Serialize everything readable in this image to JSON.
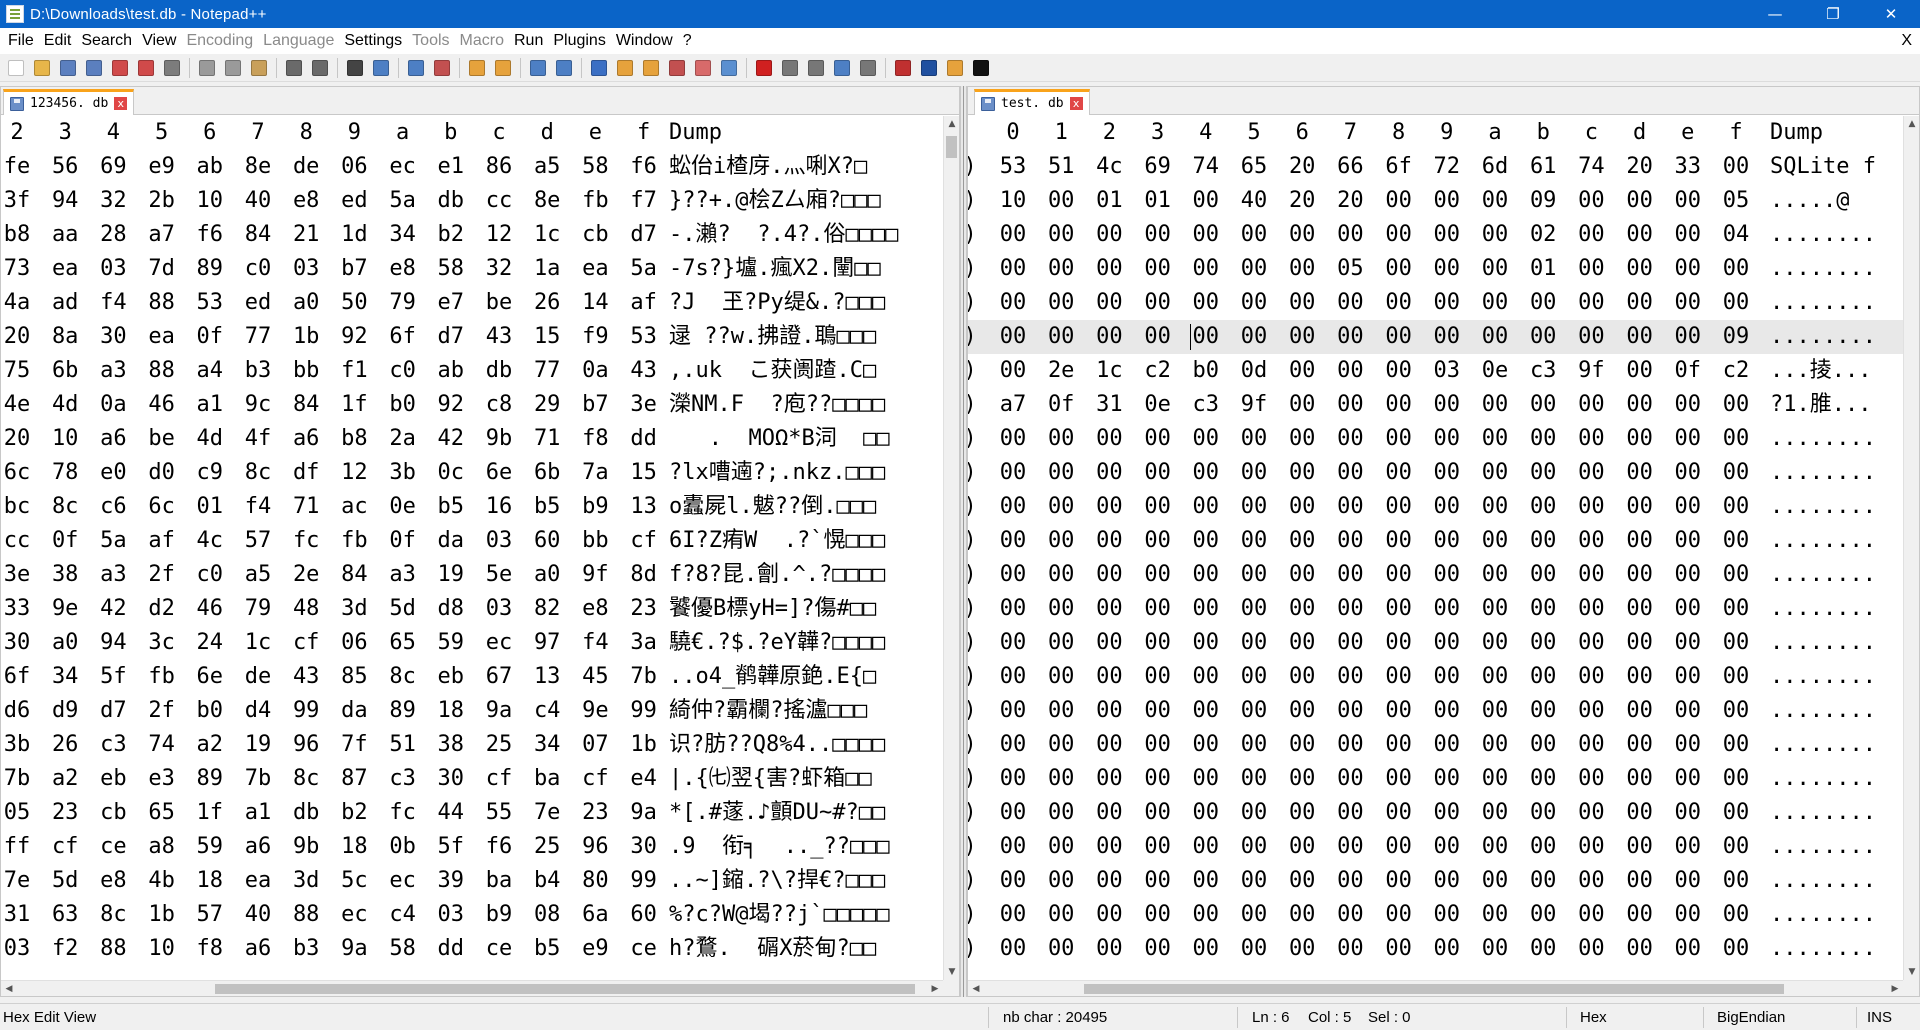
{
  "window": {
    "title": "D:\\Downloads\\test.db - Notepad++",
    "minimize": "—",
    "maximize": "❐",
    "close": "✕"
  },
  "menu": {
    "items": [
      "File",
      "Edit",
      "Search",
      "View",
      "Encoding",
      "Language",
      "Settings",
      "Tools",
      "Macro",
      "Run",
      "Plugins",
      "Window",
      "?"
    ],
    "disabled": [
      "Encoding",
      "Language",
      "Tools",
      "Macro"
    ],
    "close_doc": "X"
  },
  "toolbar": {
    "icons": [
      {
        "name": "new-file-icon",
        "color": "#ffffff"
      },
      {
        "name": "open-file-icon",
        "color": "#e7b64a"
      },
      {
        "name": "save-icon",
        "color": "#5b7fbf"
      },
      {
        "name": "save-all-icon",
        "color": "#5b7fbf"
      },
      {
        "name": "close-icon",
        "color": "#d04a4a"
      },
      {
        "name": "close-all-icon",
        "color": "#d04a4a"
      },
      {
        "name": "print-icon",
        "color": "#7c7c7c"
      },
      {
        "name": "sep"
      },
      {
        "name": "cut-icon",
        "color": "#9a9a9a"
      },
      {
        "name": "copy-icon",
        "color": "#9a9a9a"
      },
      {
        "name": "paste-icon",
        "color": "#c9a05a"
      },
      {
        "name": "sep"
      },
      {
        "name": "undo-icon",
        "color": "#6a6a6a"
      },
      {
        "name": "redo-icon",
        "color": "#6a6a6a"
      },
      {
        "name": "sep"
      },
      {
        "name": "find-icon",
        "color": "#444444"
      },
      {
        "name": "replace-icon",
        "color": "#4d7fc4"
      },
      {
        "name": "sep"
      },
      {
        "name": "zoom-in-icon",
        "color": "#4d7fc4"
      },
      {
        "name": "zoom-out-icon",
        "color": "#c25050"
      },
      {
        "name": "sep"
      },
      {
        "name": "sync-vertical-icon",
        "color": "#e6a23c"
      },
      {
        "name": "sync-horizontal-icon",
        "color": "#e6a23c"
      },
      {
        "name": "sep"
      },
      {
        "name": "word-wrap-icon",
        "color": "#4d7fc4"
      },
      {
        "name": "show-all-chars-icon",
        "color": "#4d7fc4"
      },
      {
        "name": "sep"
      },
      {
        "name": "indent-guide-icon",
        "color": "#3b6fc4"
      },
      {
        "name": "doc-map-icon",
        "color": "#e6a23c"
      },
      {
        "name": "function-list-icon",
        "color": "#e6a23c"
      },
      {
        "name": "folder-workspace-icon",
        "color": "#c25050"
      },
      {
        "name": "doc-list-icon",
        "color": "#d86a6a"
      },
      {
        "name": "monitoring-icon",
        "color": "#5a8fd0"
      },
      {
        "name": "sep"
      },
      {
        "name": "record-macro-icon",
        "color": "#d02020"
      },
      {
        "name": "stop-macro-icon",
        "color": "#777777"
      },
      {
        "name": "play-macro-icon",
        "color": "#777777"
      },
      {
        "name": "run-macro-multiple-icon",
        "color": "#4d7fc4"
      },
      {
        "name": "save-macro-icon",
        "color": "#777777"
      },
      {
        "name": "sep"
      },
      {
        "name": "spell-check-icon",
        "color": "#c03030"
      },
      {
        "name": "hex-editor-icon",
        "color": "#2050a0"
      },
      {
        "name": "explorer-icon",
        "color": "#e6a23c"
      },
      {
        "name": "markdown-icon",
        "color": "#111111"
      }
    ]
  },
  "left_pane": {
    "tab": {
      "name": "123456. db",
      "close": "x"
    },
    "header": {
      "cols": [
        "2",
        "3",
        "4",
        "5",
        "6",
        "7",
        "8",
        "9",
        "a",
        "b",
        "c",
        "d",
        "e",
        "f"
      ],
      "dump": "Dump"
    },
    "rows": [
      {
        "hex": [
          "fe",
          "56",
          "69",
          "e9",
          "ab",
          "8e",
          "de",
          "06",
          "ec",
          "e1",
          "86",
          "a5",
          "58",
          "f6"
        ],
        "dump": "蚣佁i楂庌.灬唎X?□"
      },
      {
        "hex": [
          "3f",
          "94",
          "32",
          "2b",
          "10",
          "40",
          "e8",
          "ed",
          "5a",
          "db",
          "cc",
          "8e",
          "fb",
          "f7"
        ],
        "dump": "}??+.@桧Z厶廂?□□□"
      },
      {
        "hex": [
          "b8",
          "aa",
          "28",
          "a7",
          "f6",
          "84",
          "21",
          "1d",
          "34",
          "b2",
          "12",
          "1c",
          "cb",
          "d7"
        ],
        "dump": "-.瀨?  ?.4?.俗□□□□"
      },
      {
        "hex": [
          "73",
          "ea",
          "03",
          "7d",
          "89",
          "c0",
          "03",
          "b7",
          "e8",
          "58",
          "32",
          "1a",
          "ea",
          "5a"
        ],
        "dump": "-7s?}壚.瘋X2.闉□□"
      },
      {
        "hex": [
          "4a",
          "ad",
          "f4",
          "88",
          "53",
          "ed",
          "a0",
          "50",
          "79",
          "e7",
          "be",
          "26",
          "14",
          "af"
        ],
        "dump": "?J  玊?Py缇&.?□□□"
      },
      {
        "hex": [
          "20",
          "8a",
          "30",
          "ea",
          "0f",
          "77",
          "1b",
          "92",
          "6f",
          "d7",
          "43",
          "15",
          "f9",
          "53"
        ],
        "dump": "逯 ??w.拂證.鵈□□□"
      },
      {
        "hex": [
          "75",
          "6b",
          "a3",
          "88",
          "a4",
          "b3",
          "bb",
          "f1",
          "c0",
          "ab",
          "db",
          "77",
          "0a",
          "43"
        ],
        "dump": ",.uk  こ获阓蹅.C□"
      },
      {
        "hex": [
          "4e",
          "4d",
          "0a",
          "46",
          "a1",
          "9c",
          "84",
          "1f",
          "b0",
          "92",
          "c8",
          "29",
          "b7",
          "3e"
        ],
        "dump": "濚NM.F  ?庖??□□□□"
      },
      {
        "hex": [
          "20",
          "10",
          "a6",
          "be",
          "4d",
          "4f",
          "a6",
          "b8",
          "2a",
          "42",
          "9b",
          "71",
          "f8",
          "dd"
        ],
        "dump": "   .  MOΩ*B泀  □□"
      },
      {
        "hex": [
          "6c",
          "78",
          "e0",
          "d0",
          "c9",
          "8c",
          "df",
          "12",
          "3b",
          "0c",
          "6e",
          "6b",
          "7a",
          "15"
        ],
        "dump": "?lx嘈遖?;.nkz.□□□"
      },
      {
        "hex": [
          "bc",
          "8c",
          "c6",
          "6c",
          "01",
          "f4",
          "71",
          "ac",
          "0e",
          "b5",
          "16",
          "b5",
          "b9",
          "13"
        ],
        "dump": "o蠹屍l.魃??倒.□□□"
      },
      {
        "hex": [
          "cc",
          "0f",
          "5a",
          "af",
          "4c",
          "57",
          "fc",
          "fb",
          "0f",
          "da",
          "03",
          "60",
          "bb",
          "cf"
        ],
        "dump": "6I?Z痏W  .?`愰□□□"
      },
      {
        "hex": [
          "3e",
          "38",
          "a3",
          "2f",
          "c0",
          "a5",
          "2e",
          "84",
          "a3",
          "19",
          "5e",
          "a0",
          "9f",
          "8d"
        ],
        "dump": "f?8?昆.劊.^.?□□□□"
      },
      {
        "hex": [
          "33",
          "9e",
          "42",
          "d2",
          "46",
          "79",
          "48",
          "3d",
          "5d",
          "d8",
          "03",
          "82",
          "e8",
          "23"
        ],
        "dump": "饕優B標yH=]?傷#□□"
      },
      {
        "hex": [
          "30",
          "a0",
          "94",
          "3c",
          "24",
          "1c",
          "cf",
          "06",
          "65",
          "59",
          "ec",
          "97",
          "f4",
          "3a"
        ],
        "dump": "驍€.?$.?eY韡?□□□□"
      },
      {
        "hex": [
          "6f",
          "34",
          "5f",
          "fb",
          "6e",
          "de",
          "43",
          "85",
          "8c",
          "eb",
          "67",
          "13",
          "45",
          "7b"
        ],
        "dump": "..o4_鹡韡原銫.E{□"
      },
      {
        "hex": [
          "d6",
          "d9",
          "d7",
          "2f",
          "b0",
          "d4",
          "99",
          "da",
          "89",
          "18",
          "9a",
          "c4",
          "9e",
          "99"
        ],
        "dump": "綺仲?霸欄?搖瀘□□□"
      },
      {
        "hex": [
          "3b",
          "26",
          "c3",
          "74",
          "a2",
          "19",
          "96",
          "7f",
          "51",
          "38",
          "25",
          "34",
          "07",
          "1b"
        ],
        "dump": "识?肪??Q8%4..□□□□"
      },
      {
        "hex": [
          "7b",
          "a2",
          "eb",
          "e3",
          "89",
          "7b",
          "8c",
          "87",
          "c3",
          "30",
          "cf",
          "ba",
          "cf",
          "e4"
        ],
        "dump": "|.{㈦翌{害?虾箱□□"
      },
      {
        "hex": [
          "05",
          "23",
          "cb",
          "65",
          "1f",
          "a1",
          "db",
          "b2",
          "fc",
          "44",
          "55",
          "7e",
          "23",
          "9a"
        ],
        "dump": "*[.#蓫.♪顫DU~#?□□"
      },
      {
        "hex": [
          "ff",
          "cf",
          "ce",
          "a8",
          "59",
          "a6",
          "9b",
          "18",
          "0b",
          "5f",
          "f6",
          "25",
          "96",
          "30"
        ],
        "dump": ".9  衔╕  .._??□□□"
      },
      {
        "hex": [
          "7e",
          "5d",
          "e8",
          "4b",
          "18",
          "ea",
          "3d",
          "5c",
          "ec",
          "39",
          "ba",
          "b4",
          "80",
          "99"
        ],
        "dump": "..~]鏥.?\\?捍€?□□□"
      },
      {
        "hex": [
          "31",
          "63",
          "8c",
          "1b",
          "57",
          "40",
          "88",
          "ec",
          "c4",
          "03",
          "b9",
          "08",
          "6a",
          "60"
        ],
        "dump": "%?c?W@堨??j`□□□□□"
      },
      {
        "hex": [
          "03",
          "f2",
          "88",
          "10",
          "f8",
          "a6",
          "b3",
          "9a",
          "58",
          "dd",
          "ce",
          "b5",
          "e9",
          "ce"
        ],
        "dump": "h?鶩.  碿X菸甸?□□"
      }
    ]
  },
  "right_pane": {
    "tab": {
      "name": "test. db",
      "close": "x"
    },
    "header": {
      "cols": [
        "0",
        "1",
        "2",
        "3",
        "4",
        "5",
        "6",
        "7",
        "8",
        "9",
        "a",
        "b",
        "c",
        "d",
        "e",
        "f"
      ],
      "dump": "Dump"
    },
    "highlight_row": 5,
    "rows": [
      {
        "hex": [
          "53",
          "51",
          "4c",
          "69",
          "74",
          "65",
          "20",
          "66",
          "6f",
          "72",
          "6d",
          "61",
          "74",
          "20",
          "33",
          "00"
        ],
        "dump": "SQLite f"
      },
      {
        "hex": [
          "10",
          "00",
          "01",
          "01",
          "00",
          "40",
          "20",
          "20",
          "00",
          "00",
          "00",
          "09",
          "00",
          "00",
          "00",
          "05"
        ],
        "dump": ".....@"
      },
      {
        "hex": [
          "00",
          "00",
          "00",
          "00",
          "00",
          "00",
          "00",
          "00",
          "00",
          "00",
          "00",
          "02",
          "00",
          "00",
          "00",
          "04"
        ],
        "dump": "........"
      },
      {
        "hex": [
          "00",
          "00",
          "00",
          "00",
          "00",
          "00",
          "00",
          "05",
          "00",
          "00",
          "00",
          "01",
          "00",
          "00",
          "00",
          "00"
        ],
        "dump": "........"
      },
      {
        "hex": [
          "00",
          "00",
          "00",
          "00",
          "00",
          "00",
          "00",
          "00",
          "00",
          "00",
          "00",
          "00",
          "00",
          "00",
          "00",
          "00"
        ],
        "dump": "........"
      },
      {
        "hex": [
          "00",
          "00",
          "00",
          "00",
          "00",
          "00",
          "00",
          "00",
          "00",
          "00",
          "00",
          "00",
          "00",
          "00",
          "00",
          "09"
        ],
        "dump": "........"
      },
      {
        "hex": [
          "00",
          "2e",
          "1c",
          "c2",
          "b0",
          "0d",
          "00",
          "00",
          "00",
          "03",
          "0e",
          "c3",
          "9f",
          "00",
          "0f",
          "c2"
        ],
        "dump": "...掕..."
      },
      {
        "hex": [
          "a7",
          "0f",
          "31",
          "0e",
          "c3",
          "9f",
          "00",
          "00",
          "00",
          "00",
          "00",
          "00",
          "00",
          "00",
          "00",
          "00"
        ],
        "dump": "?1.脽..."
      },
      {
        "hex": [
          "00",
          "00",
          "00",
          "00",
          "00",
          "00",
          "00",
          "00",
          "00",
          "00",
          "00",
          "00",
          "00",
          "00",
          "00",
          "00"
        ],
        "dump": "........"
      },
      {
        "hex": [
          "00",
          "00",
          "00",
          "00",
          "00",
          "00",
          "00",
          "00",
          "00",
          "00",
          "00",
          "00",
          "00",
          "00",
          "00",
          "00"
        ],
        "dump": "........"
      },
      {
        "hex": [
          "00",
          "00",
          "00",
          "00",
          "00",
          "00",
          "00",
          "00",
          "00",
          "00",
          "00",
          "00",
          "00",
          "00",
          "00",
          "00"
        ],
        "dump": "........"
      },
      {
        "hex": [
          "00",
          "00",
          "00",
          "00",
          "00",
          "00",
          "00",
          "00",
          "00",
          "00",
          "00",
          "00",
          "00",
          "00",
          "00",
          "00"
        ],
        "dump": "........"
      },
      {
        "hex": [
          "00",
          "00",
          "00",
          "00",
          "00",
          "00",
          "00",
          "00",
          "00",
          "00",
          "00",
          "00",
          "00",
          "00",
          "00",
          "00"
        ],
        "dump": "........"
      },
      {
        "hex": [
          "00",
          "00",
          "00",
          "00",
          "00",
          "00",
          "00",
          "00",
          "00",
          "00",
          "00",
          "00",
          "00",
          "00",
          "00",
          "00"
        ],
        "dump": "........"
      },
      {
        "hex": [
          "00",
          "00",
          "00",
          "00",
          "00",
          "00",
          "00",
          "00",
          "00",
          "00",
          "00",
          "00",
          "00",
          "00",
          "00",
          "00"
        ],
        "dump": "........"
      },
      {
        "hex": [
          "00",
          "00",
          "00",
          "00",
          "00",
          "00",
          "00",
          "00",
          "00",
          "00",
          "00",
          "00",
          "00",
          "00",
          "00",
          "00"
        ],
        "dump": "........"
      },
      {
        "hex": [
          "00",
          "00",
          "00",
          "00",
          "00",
          "00",
          "00",
          "00",
          "00",
          "00",
          "00",
          "00",
          "00",
          "00",
          "00",
          "00"
        ],
        "dump": "........"
      },
      {
        "hex": [
          "00",
          "00",
          "00",
          "00",
          "00",
          "00",
          "00",
          "00",
          "00",
          "00",
          "00",
          "00",
          "00",
          "00",
          "00",
          "00"
        ],
        "dump": "........"
      },
      {
        "hex": [
          "00",
          "00",
          "00",
          "00",
          "00",
          "00",
          "00",
          "00",
          "00",
          "00",
          "00",
          "00",
          "00",
          "00",
          "00",
          "00"
        ],
        "dump": "........"
      },
      {
        "hex": [
          "00",
          "00",
          "00",
          "00",
          "00",
          "00",
          "00",
          "00",
          "00",
          "00",
          "00",
          "00",
          "00",
          "00",
          "00",
          "00"
        ],
        "dump": "........"
      },
      {
        "hex": [
          "00",
          "00",
          "00",
          "00",
          "00",
          "00",
          "00",
          "00",
          "00",
          "00",
          "00",
          "00",
          "00",
          "00",
          "00",
          "00"
        ],
        "dump": "........"
      },
      {
        "hex": [
          "00",
          "00",
          "00",
          "00",
          "00",
          "00",
          "00",
          "00",
          "00",
          "00",
          "00",
          "00",
          "00",
          "00",
          "00",
          "00"
        ],
        "dump": "........"
      },
      {
        "hex": [
          "00",
          "00",
          "00",
          "00",
          "00",
          "00",
          "00",
          "00",
          "00",
          "00",
          "00",
          "00",
          "00",
          "00",
          "00",
          "00"
        ],
        "dump": "........"
      },
      {
        "hex": [
          "00",
          "00",
          "00",
          "00",
          "00",
          "00",
          "00",
          "00",
          "00",
          "00",
          "00",
          "00",
          "00",
          "00",
          "00",
          "00"
        ],
        "dump": "........"
      }
    ]
  },
  "status": {
    "mode": "Hex Edit View",
    "nb_char": "nb char : 20495",
    "ln": "Ln : 6",
    "col": "Col : 5",
    "sel": "Sel : 0",
    "view": "Hex",
    "endian": "BigEndian",
    "ins": "INS"
  }
}
